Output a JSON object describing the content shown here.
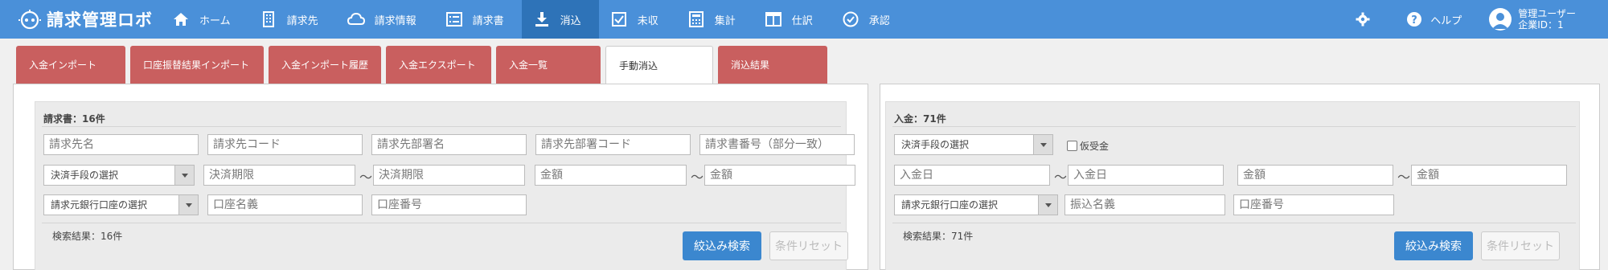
{
  "app": {
    "title": "請求管理ロボ"
  },
  "nav": {
    "items": [
      {
        "label": "ホーム",
        "icon": "home-icon"
      },
      {
        "label": "請求先",
        "icon": "building-icon"
      },
      {
        "label": "請求情報",
        "icon": "cloud-icon"
      },
      {
        "label": "請求書",
        "icon": "list-icon"
      },
      {
        "label": "消込",
        "icon": "download-icon"
      },
      {
        "label": "未収",
        "icon": "checkbox-icon"
      },
      {
        "label": "集計",
        "icon": "calculator-icon"
      },
      {
        "label": "仕訳",
        "icon": "columns-icon"
      },
      {
        "label": "承認",
        "icon": "check-circle-icon"
      }
    ],
    "active_index": 4
  },
  "header_right": {
    "settings_icon": "gear-icon",
    "help_label": "ヘルプ",
    "user_name": "管理ユーザー",
    "company_id": "企業ID：1"
  },
  "tabs": [
    {
      "label": "入金インポート"
    },
    {
      "label": "口座振替結果インポート"
    },
    {
      "label": "入金インポート履歴"
    },
    {
      "label": "入金エクスポート"
    },
    {
      "label": "入金一覧"
    },
    {
      "label": "手動消込"
    },
    {
      "label": "消込結果"
    }
  ],
  "invoice_panel": {
    "title": "請求書：16件",
    "fields": {
      "client_name": "請求先名",
      "client_code": "請求先コード",
      "dept_name": "請求先部署名",
      "dept_code": "請求先部署コード",
      "invoice_number": "請求書番号（部分一致）",
      "payment_method": "決済手段の選択",
      "due_from": "決済期限",
      "due_to": "決済期限",
      "amount_from": "金額",
      "amount_to": "金額",
      "bank_account": "請求元銀行口座の選択",
      "account_holder": "口座名義",
      "account_number": "口座番号"
    },
    "tilde": "〜",
    "result": "検索結果：16件",
    "search_button": "絞込み検索",
    "reset_button": "条件リセット"
  },
  "payment_panel": {
    "title": "入金：71件",
    "fields": {
      "payment_method": "決済手段の選択",
      "provisional": "仮受金",
      "date_from": "入金日",
      "date_to": "入金日",
      "amount_from": "金額",
      "amount_to": "金額",
      "bank_account": "請求元銀行口座の選択",
      "transfer_name": "振込名義",
      "account_number": "口座番号"
    },
    "tilde": "〜",
    "result": "検索結果：71件",
    "search_button": "絞込み検索",
    "reset_button": "条件リセット"
  },
  "colors": {
    "topbar": "#4a90d9",
    "nav_active": "#2e73b8",
    "tab": "#c95f5f",
    "primary_button": "#3b87cf"
  }
}
